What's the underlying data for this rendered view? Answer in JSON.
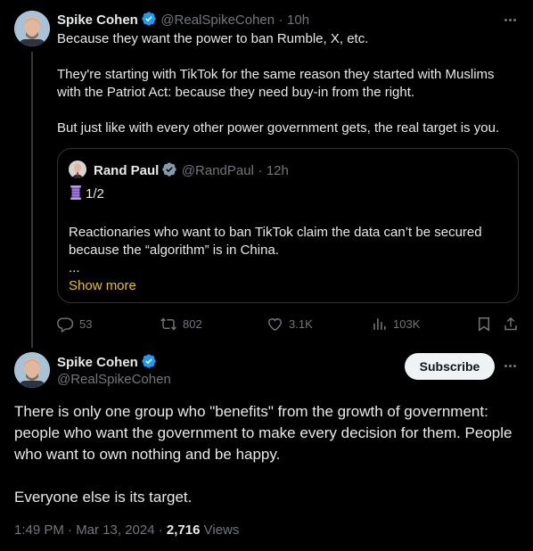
{
  "colors": {
    "background": "#000000",
    "verified": "#1d9bf0",
    "gold_check": "#829aab",
    "show_more": "#e9c300"
  },
  "tweet1": {
    "name": "Spike Cohen",
    "handle": "@RealSpikeCohen",
    "sep": "·",
    "time": "10h",
    "paragraphs": [
      "Because they want the power to ban Rumble, X, etc.",
      "They're starting with TikTok for the same reason they started with Muslims with the Patriot Act: because they need buy-in from the right.",
      "But just like with every other power government gets, the real target is you."
    ],
    "quote": {
      "name": "Rand Paul",
      "handle": "@RandPaul",
      "sep": "·",
      "time": "12h",
      "thread_marker": "1/2",
      "text": "Reactionaries who want to ban TikTok claim the data can’t be secured because the “algorithm” is in China.",
      "ellipsis": "...",
      "show_more": "Show more"
    },
    "actions": {
      "replies": "53",
      "reposts": "802",
      "likes": "3.1K",
      "views": "103K"
    }
  },
  "tweet2": {
    "name": "Spike Cohen",
    "handle": "@RealSpikeCohen",
    "subscribe_label": "Subscribe",
    "paragraphs": [
      "There is only one group who \"benefits\" from the growth of government: people who want the government to make every decision for them. People who want to own nothing and be happy.",
      "Everyone else is its target."
    ],
    "timestamp": "1:49 PM · Mar 13, 2024 · ",
    "view_count": "2,716",
    "views_label": " Views"
  },
  "icons": [
    "more-icon",
    "verified-icon",
    "reply-icon",
    "repost-icon",
    "like-icon",
    "views-icon",
    "bookmark-icon",
    "share-icon",
    "thread-icon"
  ]
}
